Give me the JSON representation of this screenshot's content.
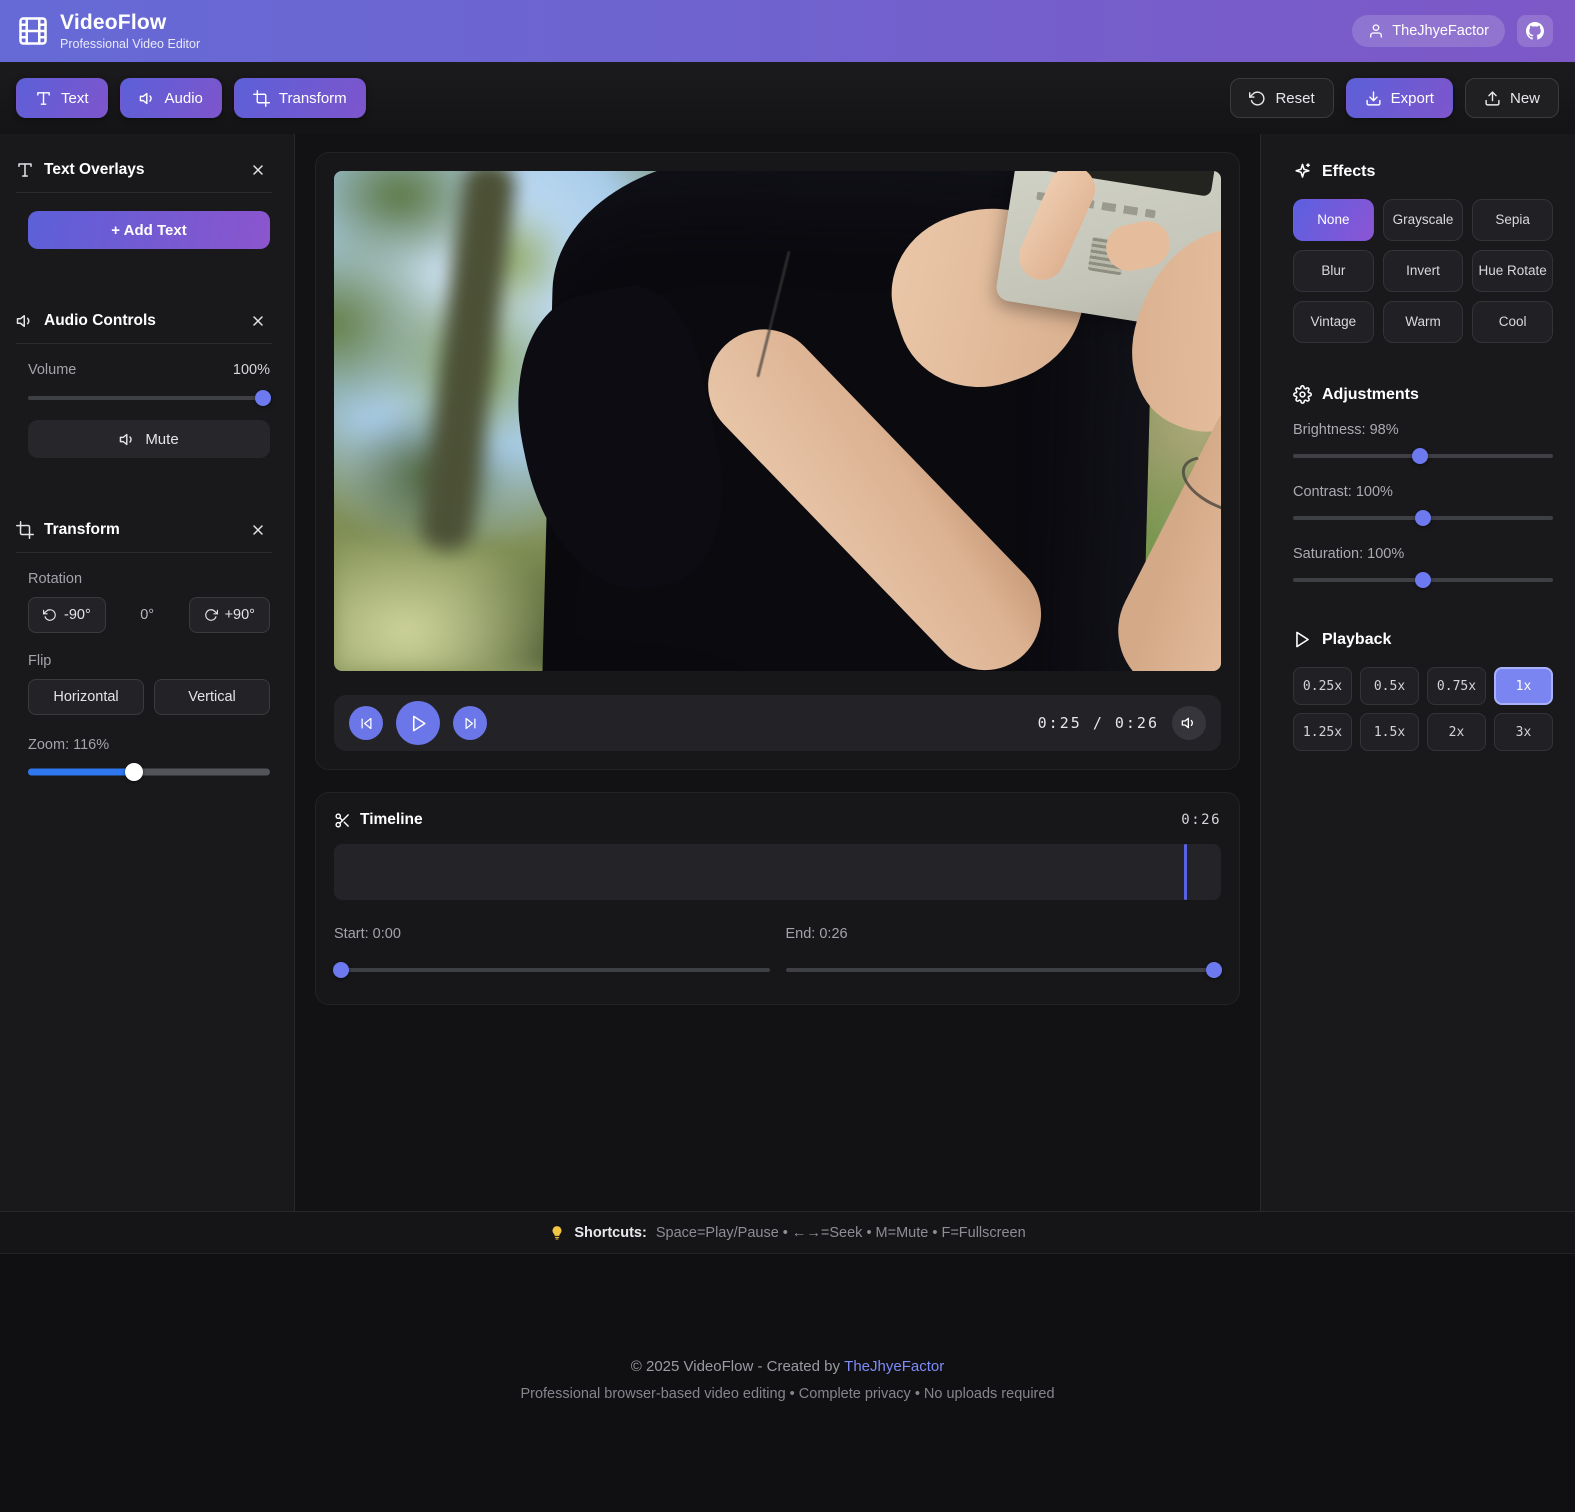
{
  "header": {
    "app_name": "VideoFlow",
    "app_subtitle": "Professional Video Editor",
    "username": "TheJhyeFactor"
  },
  "toolbar": {
    "text_label": "Text",
    "audio_label": "Audio",
    "transform_label": "Transform",
    "reset_label": "Reset",
    "export_label": "Export",
    "new_label": "New"
  },
  "text_overlays": {
    "title": "Text Overlays",
    "add_button": "+ Add Text"
  },
  "audio_controls": {
    "title": "Audio Controls",
    "volume_label": "Volume",
    "volume_value": "100%",
    "mute_label": "Mute"
  },
  "transform": {
    "title": "Transform",
    "rotation_label": "Rotation",
    "rotate_ccw": "-90°",
    "rotation_value": "0°",
    "rotate_cw": "+90°",
    "flip_label": "Flip",
    "flip_horizontal": "Horizontal",
    "flip_vertical": "Vertical",
    "zoom_label": "Zoom: 116%"
  },
  "player": {
    "current_time": "0:25",
    "separator": "/",
    "duration": "0:26"
  },
  "timeline": {
    "title": "Timeline",
    "duration": "0:26",
    "start_label": "Start: 0:00",
    "end_label": "End: 0:26"
  },
  "effects": {
    "title": "Effects",
    "active": "None",
    "options": [
      "None",
      "Grayscale",
      "Sepia",
      "Blur",
      "Invert",
      "Hue Rotate",
      "Vintage",
      "Warm",
      "Cool"
    ]
  },
  "adjustments": {
    "title": "Adjustments",
    "brightness_label": "Brightness: 98%",
    "contrast_label": "Contrast: 100%",
    "saturation_label": "Saturation: 100%"
  },
  "playback": {
    "title": "Playback",
    "active": "1x",
    "speeds": [
      "0.25x",
      "0.5x",
      "0.75x",
      "1x",
      "1.25x",
      "1.5x",
      "2x",
      "3x"
    ]
  },
  "footer": {
    "shortcuts_label": "Shortcuts:",
    "shortcuts_text": "Space=Play/Pause • ←→=Seek • M=Mute • F=Fullscreen",
    "copyright_prefix": "© 2025 VideoFlow - Created by",
    "credit_link": "TheJhyeFactor",
    "tagline": "Professional browser-based video editing • Complete privacy • No uploads required"
  },
  "colors": {
    "accent_indigo": "#5c60d8",
    "accent_purple": "#7e55cc",
    "slider_thumb": "#6d79ee",
    "zoom_fill": "#2f77f0",
    "playhead": "#5663e6",
    "link": "#7d8bf6"
  }
}
